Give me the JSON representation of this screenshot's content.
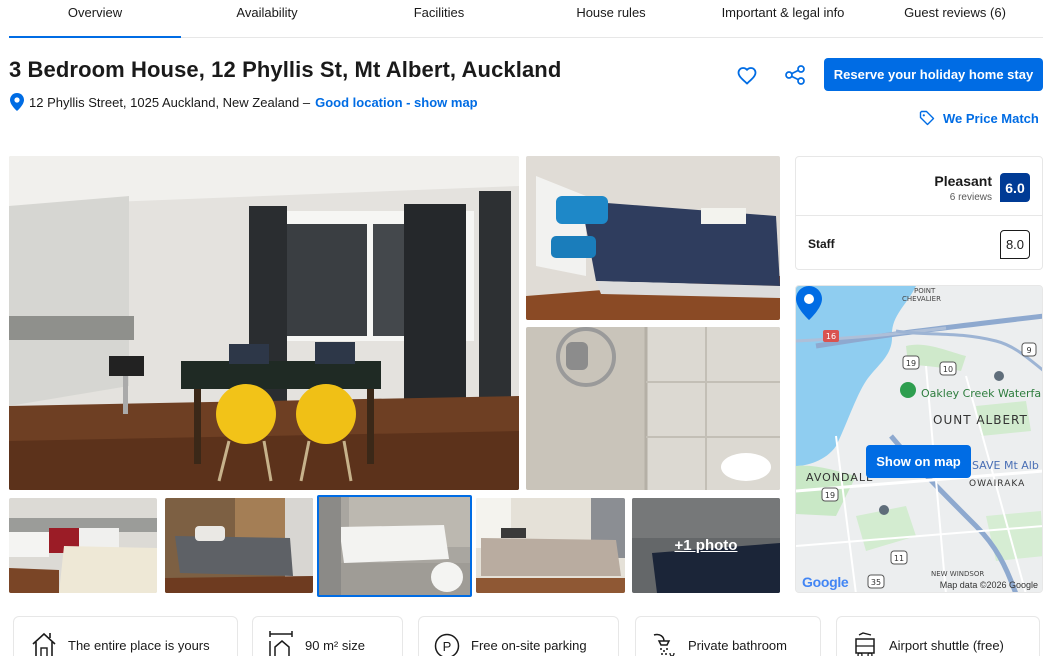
{
  "tabs": [
    "Overview",
    "Availability",
    "Facilities",
    "House rules",
    "Important & legal info",
    "Guest reviews (6)"
  ],
  "property": {
    "title": "3 Bedroom House, 12 Phyllis St, Mt Albert, Auckland",
    "address": "12 Phyllis Street, 1025 Auckland, New Zealand –",
    "location_link": "Good location - show map"
  },
  "actions": {
    "reserve_label": "Reserve your holiday home stay",
    "price_match_label": "We Price Match"
  },
  "gallery": {
    "more_photos_label": "+1 photo"
  },
  "review": {
    "score_word": "Pleasant",
    "count": "6 reviews",
    "score": "6.0",
    "subscore_label": "Staff",
    "subscore_value": "8.0"
  },
  "map": {
    "labels": {
      "point_chevalier_1": "POINT",
      "point_chevalier_2": "CHEVALIER",
      "oakley": "Oakley Creek Waterfa",
      "mount_albert": "OUNT ALBERT",
      "avondale": "AVONDALE",
      "save": "SAVE Mt Alb",
      "owairaka": "OWAIRAKA",
      "new_windsor": "NEW WINDSOR"
    },
    "shields": [
      "16",
      "19",
      "10",
      "9",
      "19",
      "11",
      "35"
    ],
    "show_map_label": "Show on map",
    "google_label": "Google",
    "map_data_label": "Map data ©2026 Google"
  },
  "amenities": [
    {
      "label": "The entire place is yours",
      "icon": "house-icon"
    },
    {
      "label": "90 m² size",
      "icon": "size-icon"
    },
    {
      "label": "Free on-site parking",
      "icon": "parking-icon"
    },
    {
      "label": "Private bathroom",
      "icon": "shower-icon"
    },
    {
      "label": "Airport shuttle (free)",
      "icon": "shuttle-icon"
    }
  ],
  "colors": {
    "brand_blue": "#006ce4",
    "score_badge": "#003b95"
  }
}
